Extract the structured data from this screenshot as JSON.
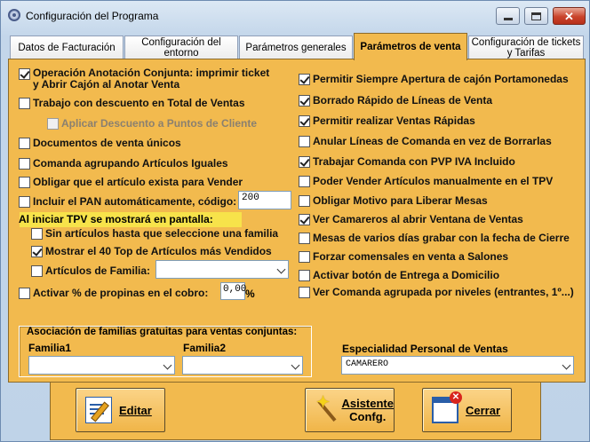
{
  "window": {
    "title": "Configuración del Programa"
  },
  "tabs": [
    {
      "label": "Datos de Facturación",
      "active": false
    },
    {
      "label": "Configuración del entorno",
      "active": false
    },
    {
      "label": "Parámetros generales",
      "active": false
    },
    {
      "label": "Parámetros de venta",
      "active": true
    },
    {
      "label": "Configuración de tickets y Tarifas",
      "active": false
    }
  ],
  "left_options": {
    "operacion_conjunta": {
      "label": "Operación Anotación Conjunta: imprimir ticket y Abrir Cajón al Anotar Venta",
      "checked": true
    },
    "trabajo_descuento": {
      "label": "Trabajo con descuento en Total de Ventas",
      "checked": false
    },
    "aplicar_descuento": {
      "label": "Aplicar Descuento a Puntos de Cliente",
      "checked": false,
      "disabled": true
    },
    "documentos_unicos": {
      "label": "Documentos de venta únicos",
      "checked": false
    },
    "comanda_agrupando": {
      "label": "Comanda agrupando Artículos Iguales",
      "checked": false
    },
    "obligar_articulo": {
      "label": "Obligar que el artículo exista para Vender",
      "checked": false
    },
    "incluir_pan": {
      "label": "Incluir el PAN automáticamente, código:",
      "checked": false,
      "value": "200"
    },
    "al_iniciar_label": "Al iniciar TPV se mostrará en pantalla:",
    "sin_articulos": {
      "label": "Sin artículos hasta que seleccione una familia",
      "checked": false
    },
    "mostrar_top40": {
      "label": "Mostrar el 40 Top de Artículos más Vendidos",
      "checked": true
    },
    "articulos_familia": {
      "label": "Artículos de Familia:",
      "checked": false
    },
    "activar_propinas": {
      "label": "Activar % de propinas en el cobro:",
      "checked": false,
      "value": "0,00",
      "suffix": "%"
    }
  },
  "right_options": [
    {
      "label": "Permitir Siempre Apertura de cajón Portamonedas",
      "checked": true
    },
    {
      "label": "Borrado Rápido de Líneas de Venta",
      "checked": true
    },
    {
      "label": "Permitir realizar Ventas Rápidas",
      "checked": true
    },
    {
      "label": "Anular Líneas de Comanda en vez de Borrarlas",
      "checked": false
    },
    {
      "label": "Trabajar Comanda con PVP IVA Incluido",
      "checked": true
    },
    {
      "label": "Poder Vender Artículos manualmente en el TPV",
      "checked": false
    },
    {
      "label": "Obligar Motivo para Liberar Mesas",
      "checked": false
    },
    {
      "label": "Ver Camareros al abrir Ventana de Ventas",
      "checked": true
    },
    {
      "label": "Mesas de varios días grabar con la fecha de Cierre",
      "checked": false
    },
    {
      "label": "Forzar comensales en venta a Salones",
      "checked": false
    },
    {
      "label": "Activar botón de Entrega a Domicilio",
      "checked": false
    },
    {
      "label": "Ver Comanda agrupada por niveles (entrantes, 1º...)",
      "checked": false
    }
  ],
  "familias_group": {
    "title": "Asociación de familias gratuitas para ventas conjuntas:",
    "familia1_label": "Familia1",
    "familia2_label": "Familia2",
    "familia1_value": "",
    "familia2_value": ""
  },
  "especialidad": {
    "label": "Especialidad Personal de Ventas",
    "value": "CAMARERO"
  },
  "buttons": {
    "editar": "Editar",
    "asistente_line1": "Asistente",
    "asistente_line2": "Confg.",
    "cerrar": "Cerrar"
  }
}
